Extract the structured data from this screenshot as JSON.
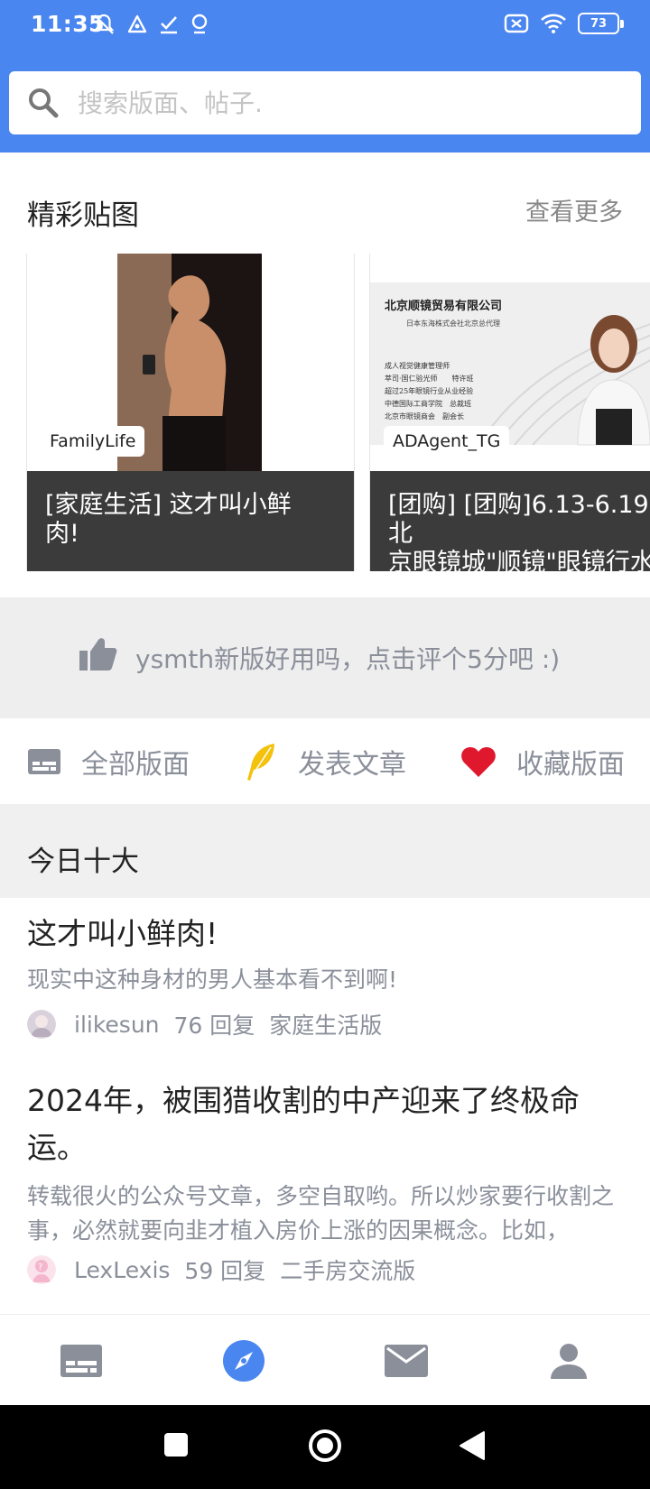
{
  "status_bar": {
    "time": "11:35",
    "battery": "73"
  },
  "search": {
    "placeholder": "搜索版面、帖子."
  },
  "featured": {
    "title": "精彩贴图",
    "more": "查看更多",
    "cards": [
      {
        "tag": "FamilyLife",
        "caption": "[家庭生活] 这才叫小鲜\n肉!"
      },
      {
        "tag": "ADAgent_TG",
        "caption": "[团购] [团购]6.13-6.19 北\n京眼镜城\"顺镜\"眼镜行水"
      }
    ],
    "ad_text": {
      "company": "北京顺镜贸易有限公司",
      "sub": "日本东海株式会社北京总代理",
      "lines": [
        "成人视觉健康管理师",
        "萃司·国仁验光师　　特许班",
        "超过25年眼镜行业从业经验",
        "中德国际工商学院　总裁班",
        "北京市眼镜商会　副会长"
      ]
    }
  },
  "rate_banner": {
    "text": "ysmth新版好用吗，点击评个5分吧 :)"
  },
  "actions": [
    {
      "label": "全部版面",
      "icon": "board-list-icon"
    },
    {
      "label": "发表文章",
      "icon": "feather-pen-icon"
    },
    {
      "label": "收藏版面",
      "icon": "heart-icon"
    }
  ],
  "top_ten": {
    "title": "今日十大",
    "posts": [
      {
        "title": "这才叫小鲜肉!",
        "desc": "现实中这种身材的男人基本看不到啊!",
        "author": "ilikesun",
        "replies": "76 回复",
        "board": "家庭生活版"
      },
      {
        "title": "2024年，被围猎收割的中产迎来了终极命运。",
        "desc": "转载很火的公众号文章，多空自取哟。所以炒家要行收割之事，必然就要向韭才植入房价上涨的因果概念。比如，",
        "author": "LexLexis",
        "replies": "59 回复",
        "board": "二手房交流版"
      }
    ]
  },
  "bottom_nav": [
    "boards-icon",
    "discover-compass-icon",
    "mail-icon",
    "profile-icon"
  ],
  "colors": {
    "header": "#4a86f0",
    "accent": "#4a86f0",
    "heart": "#e0182d",
    "feather": "#f4c20d"
  }
}
